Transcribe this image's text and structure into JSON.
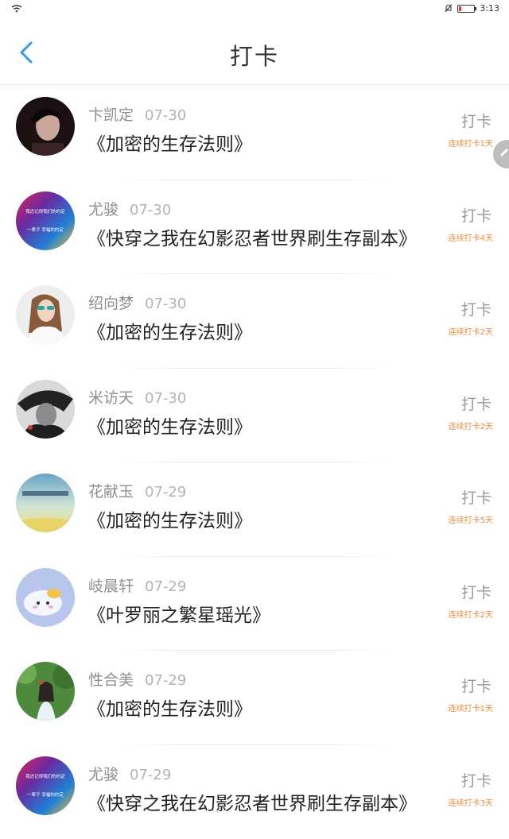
{
  "status_bar": {
    "time": "3:13"
  },
  "header": {
    "title": "打卡"
  },
  "colors": {
    "accent": "#2f9cf0",
    "streak": "#f08a3c"
  },
  "items": [
    {
      "name": "卞凯定",
      "date": "07-30",
      "book": "《加密的生存法则》",
      "action": "打卡",
      "streak": "连续打卡1天",
      "avatar": "dark-portrait"
    },
    {
      "name": "尤骏",
      "date": "07-30",
      "book": "《快穿之我在幻影忍者世界刷生存副本》",
      "action": "打卡",
      "streak": "连续打卡4天",
      "avatar": "gradient-text",
      "avatar_text": [
        "我还记得我们的约定",
        "一辈子 幸福的约定"
      ]
    },
    {
      "name": "绍向梦",
      "date": "07-30",
      "book": "《加密的生存法则》",
      "action": "打卡",
      "streak": "连续打卡2天",
      "avatar": "girl-sunglasses"
    },
    {
      "name": "米访天",
      "date": "07-30",
      "book": "《加密的生存法则》",
      "action": "打卡",
      "streak": "连续打卡2天",
      "avatar": "bw-portrait"
    },
    {
      "name": "花献玉",
      "date": "07-29",
      "book": "《加密的生存法则》",
      "action": "打卡",
      "streak": "连续打卡5天",
      "avatar": "sky-landscape"
    },
    {
      "name": "岐晨轩",
      "date": "07-29",
      "book": "《叶罗丽之繁星瑶光》",
      "action": "打卡",
      "streak": "连续打卡2天",
      "avatar": "cute-cartoon"
    },
    {
      "name": "性合美",
      "date": "07-29",
      "book": "《加密的生存法则》",
      "action": "打卡",
      "streak": "连续打卡1天",
      "avatar": "green-garden"
    },
    {
      "name": "尤骏",
      "date": "07-29",
      "book": "《快穿之我在幻影忍者世界刷生存副本》",
      "action": "打卡",
      "streak": "连续打卡3天",
      "avatar": "gradient-text",
      "avatar_text": [
        "我还记得我们的约定",
        "一辈子 幸福的约定"
      ]
    }
  ]
}
